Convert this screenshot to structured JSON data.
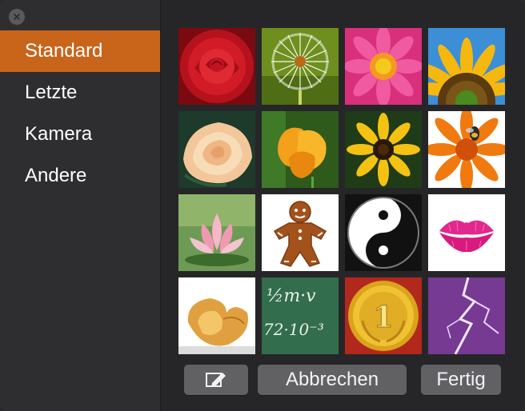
{
  "window": {
    "close_icon": "close-icon"
  },
  "sidebar": {
    "items": [
      {
        "label": "Standard",
        "selected": true
      },
      {
        "label": "Letzte",
        "selected": false
      },
      {
        "label": "Kamera",
        "selected": false
      },
      {
        "label": "Andere",
        "selected": false
      }
    ],
    "accent_color": "#c8651b"
  },
  "pictures": [
    "red rose",
    "dandelion",
    "pink daisy",
    "sunflower",
    "peach rose",
    "orange poppy",
    "black-eyed susan",
    "orange gerbera with bee",
    "lotus",
    "gingerbread man",
    "yin yang",
    "lipstick kiss",
    "fortune cookie",
    "chalkboard math",
    "gold medal",
    "lightning"
  ],
  "chalkboard_text": {
    "line1": "½m·v",
    "line2": "72·10⁻³"
  },
  "medal_text": "1",
  "footer": {
    "edit_icon": "edit-pencil-icon",
    "cancel_label": "Abbrechen",
    "done_label": "Fertig"
  }
}
